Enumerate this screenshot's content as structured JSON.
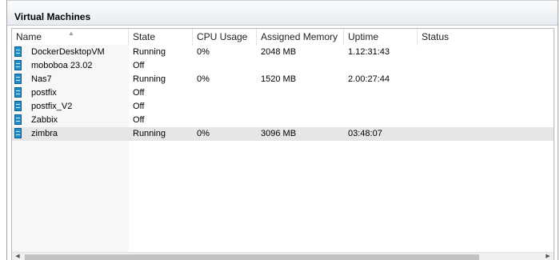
{
  "panel": {
    "title": "Virtual Machines"
  },
  "columns": [
    "Name",
    "State",
    "CPU Usage",
    "Assigned Memory",
    "Uptime",
    "Status"
  ],
  "vms": [
    {
      "name": "DockerDesktopVM",
      "state": "Running",
      "cpu": "0%",
      "memory": "2048 MB",
      "uptime": "1.12:31:43",
      "status": ""
    },
    {
      "name": "moboboa 23.02",
      "state": "Off",
      "cpu": "",
      "memory": "",
      "uptime": "",
      "status": ""
    },
    {
      "name": "Nas7",
      "state": "Running",
      "cpu": "0%",
      "memory": "1520 MB",
      "uptime": "2.00:27:44",
      "status": ""
    },
    {
      "name": "postfix",
      "state": "Off",
      "cpu": "",
      "memory": "",
      "uptime": "",
      "status": ""
    },
    {
      "name": "postfix_V2",
      "state": "Off",
      "cpu": "",
      "memory": "",
      "uptime": "",
      "status": ""
    },
    {
      "name": "Zabbix",
      "state": "Off",
      "cpu": "",
      "memory": "",
      "uptime": "",
      "status": ""
    },
    {
      "name": "zimbra",
      "state": "Running",
      "cpu": "0%",
      "memory": "3096 MB",
      "uptime": "03:48:07",
      "status": ""
    }
  ],
  "selected_vm": "zimbra",
  "icons": {
    "vm": "virtual-machine-icon",
    "sort": "sort-ascending-icon"
  },
  "colors": {
    "vm_icon": "#1d8dc7",
    "selected_row": "#e6e6e6",
    "name_column_bg": "#f7f7f7"
  }
}
